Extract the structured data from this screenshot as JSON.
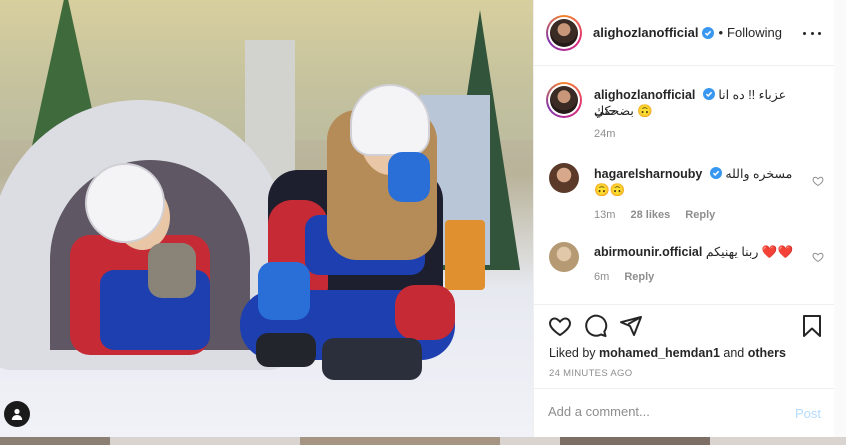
{
  "post": {
    "author": "alighozlanofficial",
    "separator": "•",
    "follow_status": "Following",
    "more_icon": "more-horizontal-icon"
  },
  "caption": {
    "author": "alighozlanofficial",
    "text_line1": "عزباء !! ده انا حتي",
    "text_line2": "بضحكك 🙃",
    "age": "24m"
  },
  "comments": [
    {
      "author": "hagarelsharnouby",
      "text_line1": "مسخره والله 🙃",
      "text_line2": "🙃🙃",
      "age": "13m",
      "likes": "28 likes",
      "reply": "Reply"
    },
    {
      "author": "abirmounir.official",
      "text_line1": "ربنا يهنيكم ❤️❤️",
      "age": "6m",
      "reply": "Reply"
    }
  ],
  "actions": {
    "like_icon": "heart-icon",
    "comment_icon": "comment-icon",
    "share_icon": "share-icon",
    "save_icon": "bookmark-icon"
  },
  "likes": {
    "prefix": "Liked by",
    "user": "mohamed_hemdan1",
    "and": "and",
    "others": "others"
  },
  "timestamp": "24 MINUTES AGO",
  "add_comment": {
    "placeholder": "Add a comment...",
    "post_label": "Post"
  },
  "colors": {
    "verified_blue": "#3897f0",
    "post_disabled": "#b3dbff",
    "meta_grey": "#8e8e8e"
  }
}
